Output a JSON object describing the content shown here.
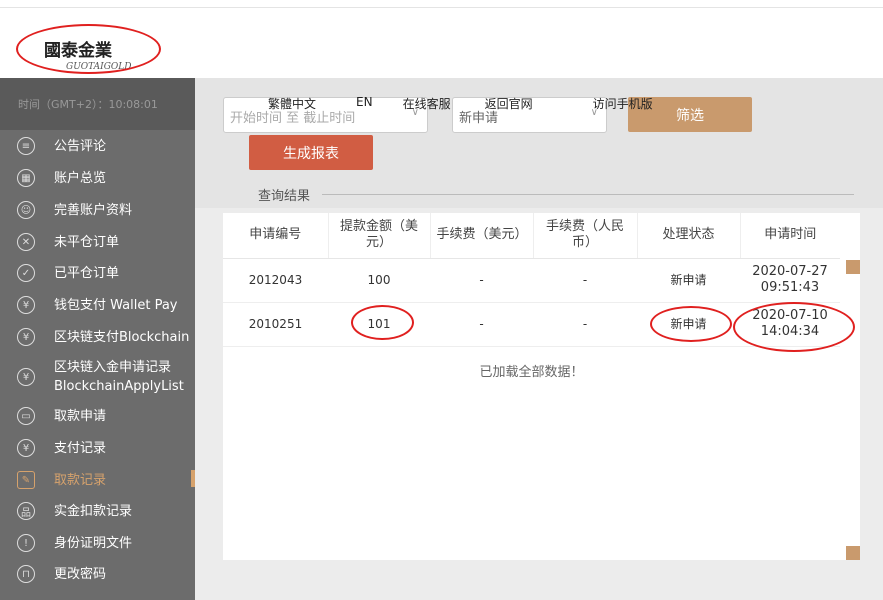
{
  "logo": {
    "name": "國泰金業",
    "sub": "GUOTAIGOLD"
  },
  "clock": "时间（GMT+2）：10:08:01",
  "topnav": [
    "繁體中文",
    "EN",
    "在线客服",
    "返回官网",
    "访问手机版"
  ],
  "filters": {
    "date_placeholder": "开始时间 至 截止时间",
    "status_value": "新申请",
    "filter_button": "筛选",
    "report_button": "生成报表"
  },
  "result_label": "查询结果",
  "sidebar": {
    "items": [
      {
        "label": "公告评论",
        "icon": "announcement-icon"
      },
      {
        "label": "账户总览",
        "icon": "grid-icon"
      },
      {
        "label": "完善账户资料",
        "icon": "profile-icon"
      },
      {
        "label": "未平仓订单",
        "icon": "order-open-icon"
      },
      {
        "label": "已平仓订单",
        "icon": "order-closed-icon"
      },
      {
        "label": "钱包支付 Wallet Pay",
        "icon": "yen-icon"
      },
      {
        "label": "区块链支付Blockchain",
        "icon": "yen-icon"
      },
      {
        "label": "区块链入金申请记录\nBlockchainApplyList",
        "icon": "yen-icon"
      },
      {
        "label": "取款申请",
        "icon": "wallet-icon"
      },
      {
        "label": "支付记录",
        "icon": "yen-icon"
      },
      {
        "label": "取款记录",
        "icon": "edit-icon",
        "active": true
      },
      {
        "label": "实金扣款记录",
        "icon": "blocks-icon"
      },
      {
        "label": "身份证明文件",
        "icon": "alarm-icon"
      },
      {
        "label": "更改密码",
        "icon": "lock-icon"
      }
    ]
  },
  "table": {
    "headers": [
      "申请编号",
      "提款金额（美元）",
      "手续费（美元）",
      "手续费（人民币）",
      "处理状态",
      "申请时间"
    ],
    "rows": [
      [
        "2012043",
        "100",
        "-",
        "-",
        "新申请",
        "2020-07-27\n09:51:43"
      ],
      [
        "2010251",
        "101",
        "-",
        "-",
        "新申请",
        "2020-07-10\n14:04:34"
      ]
    ],
    "footer": "已加载全部数据！"
  },
  "colors": {
    "accent": "#c99a6d",
    "report": "#d15d43",
    "sidebar": "#6c6c6c",
    "annotation": "#e0201f"
  }
}
